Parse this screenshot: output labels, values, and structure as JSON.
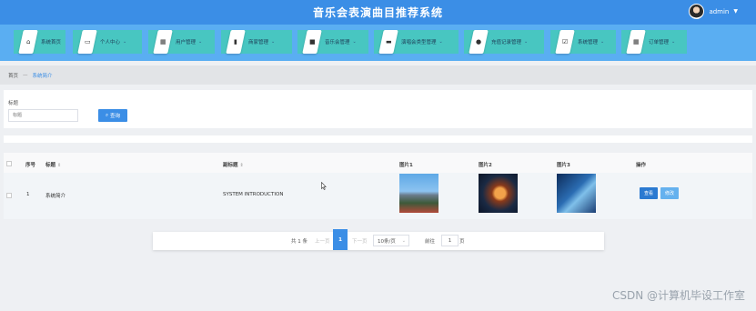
{
  "header": {
    "title": "音乐会表演曲目推荐系统",
    "user": "admin"
  },
  "nav": [
    {
      "label": "系统首页",
      "icon": "home-icon",
      "chevron": false
    },
    {
      "label": "个人中心",
      "icon": "id-card-icon",
      "chevron": true
    },
    {
      "label": "用户管理",
      "icon": "grid-icon",
      "chevron": true
    },
    {
      "label": "商家管理",
      "icon": "book-icon",
      "chevron": true
    },
    {
      "label": "音乐会管理",
      "icon": "film-icon",
      "chevron": true
    },
    {
      "label": "演唱会类型管理",
      "icon": "monitor-icon",
      "chevron": true
    },
    {
      "label": "充值记录管理",
      "icon": "user-icon",
      "chevron": true
    },
    {
      "label": "系统管理",
      "icon": "check-square-icon",
      "chevron": true
    },
    {
      "label": "订单管理",
      "icon": "grid-icon",
      "chevron": true
    }
  ],
  "breadcrumb": {
    "home": "首页",
    "separator": "—",
    "current": "系统简介"
  },
  "search": {
    "label": "标题",
    "placeholder": "标题",
    "button": "查询"
  },
  "table": {
    "columns": [
      "序号",
      "标题",
      "副标题",
      "图片1",
      "图片2",
      "图片3",
      "操作"
    ],
    "rows": [
      {
        "index": "1",
        "title": "系统简介",
        "subtitle": "SYSTEM INTRODUCTION",
        "view": "查看",
        "edit": "修改"
      }
    ]
  },
  "pagination": {
    "total": "共 1 条",
    "prev": "上一页",
    "current": "1",
    "next": "下一页",
    "page_size": "10条/页",
    "goto_prefix": "前往",
    "goto_value": "1",
    "goto_suffix": "页"
  },
  "watermark": "CSDN @计算机毕设工作室",
  "colors": {
    "header": "#3b8ee6",
    "nav_bar": "#5aaef2",
    "nav_item": "#48c6c1",
    "primary_button": "#3b8ee6"
  }
}
